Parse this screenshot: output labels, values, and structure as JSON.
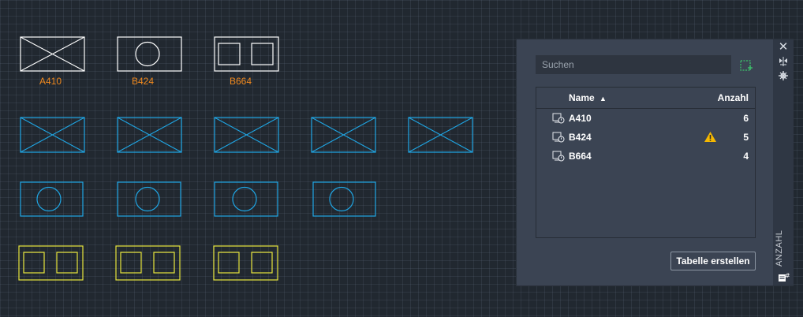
{
  "colors": {
    "background": "#212830",
    "white_block": "#ffffff",
    "cyan_block": "#1fa7e6",
    "yellow_block": "#e8e63c",
    "label": "#f28a1e",
    "warning": "#f5b800",
    "panel": "#3b4453"
  },
  "drawing": {
    "labels": [
      "A410",
      "B424",
      "B664"
    ]
  },
  "palette": {
    "title": "ANZAHL",
    "search_placeholder": "Suchen",
    "icons": {
      "close": "close-icon",
      "autohide": "autohide-icon",
      "properties": "properties-icon",
      "select": "select-objects-icon",
      "corner": "palette-menu-icon"
    },
    "columns": {
      "name": "Name",
      "name_sort": "▲",
      "count": "Anzahl"
    },
    "rows": [
      {
        "name": "A410",
        "count": "6",
        "warning": false
      },
      {
        "name": "B424",
        "count": "5",
        "warning": true
      },
      {
        "name": "B664",
        "count": "4",
        "warning": false
      }
    ],
    "create_table_button": "Tabelle erstellen"
  }
}
